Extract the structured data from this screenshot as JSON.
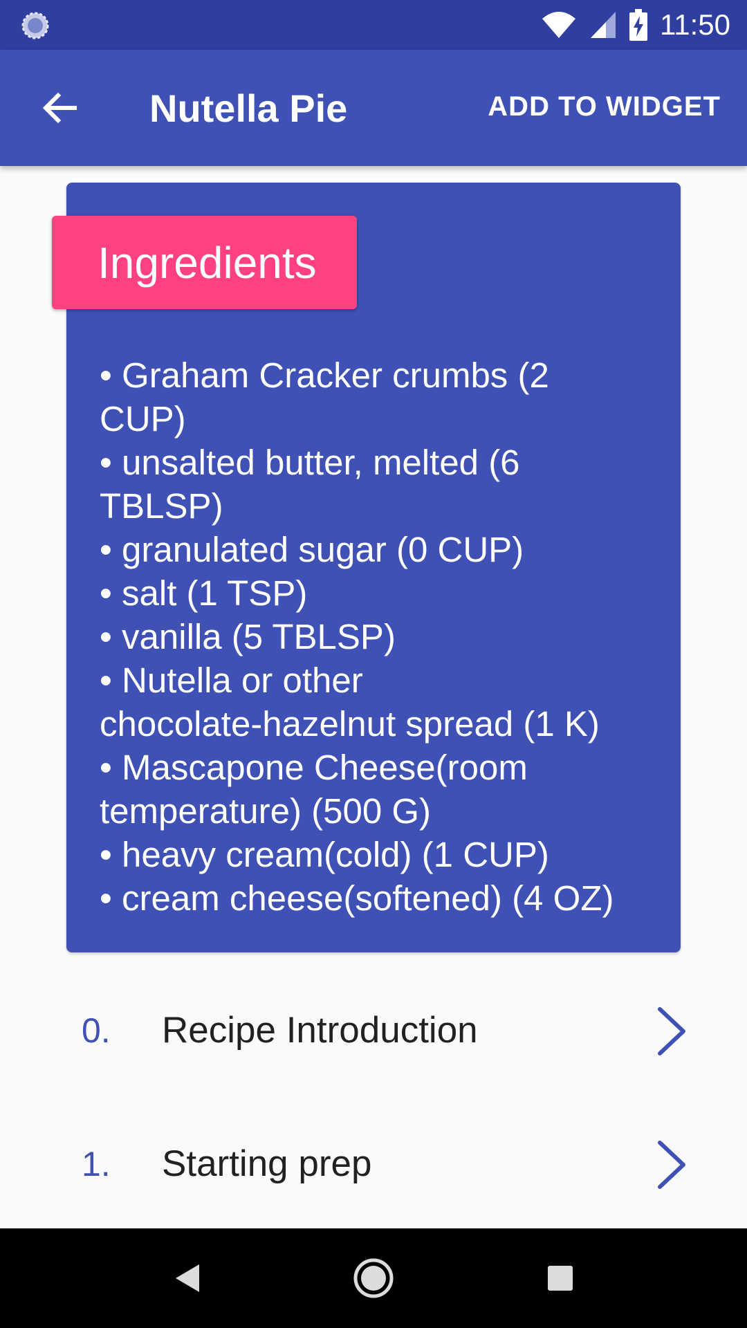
{
  "status_bar": {
    "time": "11:50",
    "icons": [
      "sync-icon",
      "wifi-icon",
      "signal-icon",
      "battery-charging-icon"
    ]
  },
  "app_bar": {
    "title": "Nutella Pie",
    "action_label": "ADD TO WIDGET",
    "back_icon": "arrow-back-icon"
  },
  "ingredients": {
    "heading": "Ingredients",
    "items": [
      "• Graham Cracker crumbs (2",
      "CUP)",
      "• unsalted butter, melted (6",
      "TBLSP)",
      "• granulated sugar (0 CUP)",
      "• salt (1 TSP)",
      "• vanilla (5 TBLSP)",
      "• Nutella or other",
      "chocolate-hazelnut spread (1 K)",
      "• Mascapone Cheese(room",
      "temperature) (500 G)",
      "• heavy cream(cold) (1 CUP)",
      "• cream cheese(softened) (4 OZ)"
    ]
  },
  "steps": [
    {
      "number": "0.",
      "title": "Recipe Introduction"
    },
    {
      "number": "1.",
      "title": "Starting prep"
    }
  ],
  "colors": {
    "primary": "#3f51b5",
    "primary_dark": "#303f9f",
    "accent": "#ff4081",
    "background": "#fafafa"
  },
  "nav_bar": {
    "icons": [
      "nav-back-icon",
      "nav-home-icon",
      "nav-recents-icon"
    ]
  }
}
